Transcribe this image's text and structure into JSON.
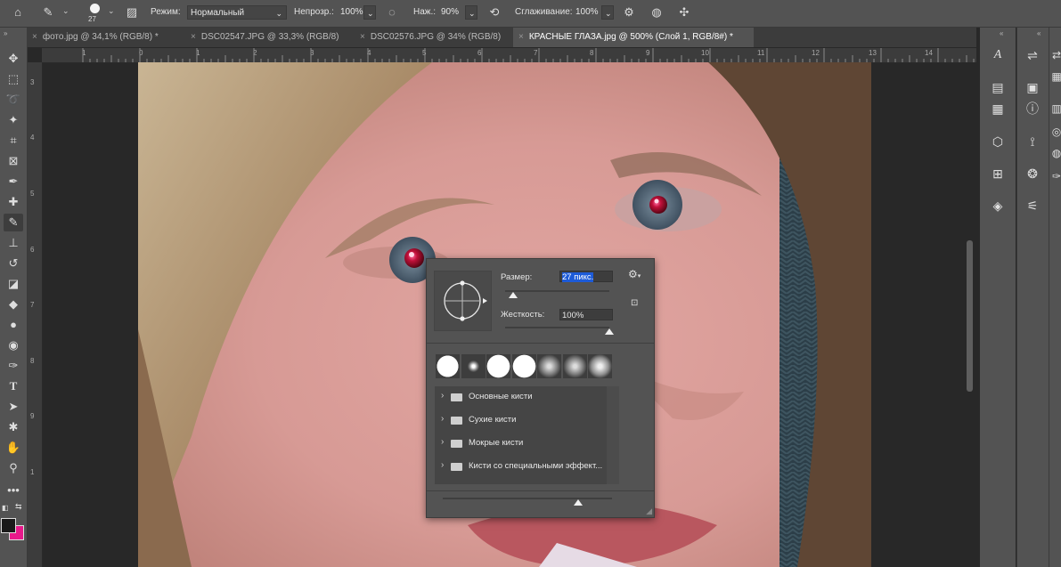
{
  "options_bar": {
    "brush_size": "27",
    "mode_label": "Режим:",
    "mode_value": "Нормальный",
    "opacity_label": "Непрозр.:",
    "opacity_value": "100%",
    "pressure_label": "Наж.:",
    "pressure_value": "90%",
    "smoothing_label": "Сглаживание:",
    "smoothing_value": "100%"
  },
  "tabs": [
    {
      "label": "фото.jpg @ 34,1% (RGB/8) *",
      "active": false
    },
    {
      "label": "DSC02547.JPG @ 33,3% (RGB/8)",
      "active": false
    },
    {
      "label": "DSC02576.JPG @ 34% (RGB/8)",
      "active": false
    },
    {
      "label": "КРАСНЫЕ ГЛАЗА.jpg @ 500% (Слой 1, RGB/8#) *",
      "active": true
    }
  ],
  "ruler": {
    "h_ticks": [
      "1",
      "0",
      "1",
      "2",
      "3",
      "4",
      "5",
      "6",
      "7",
      "8",
      "9",
      "10",
      "11",
      "12",
      "13",
      "14"
    ],
    "v_ticks": [
      "3",
      "4",
      "5",
      "6",
      "7",
      "8",
      "9",
      "1"
    ]
  },
  "brush_popup": {
    "size_label": "Размер:",
    "size_value": "27 пикс.",
    "size_slider": 0.08,
    "hardness_label": "Жесткость:",
    "hardness_value": "100%",
    "hardness_slider": 1.0,
    "presets": [
      "hard-round",
      "soft-round-small",
      "hard-round-large",
      "hard-round-pressure",
      "soft-round-airbrush",
      "soft-round-pressure",
      "soft-round-large"
    ],
    "folders": [
      "Основные кисти",
      "Сухие кисти",
      "Мокрые кисти",
      "Кисти со специальными эффект..."
    ],
    "bottom_slider": 0.8
  },
  "colors": {
    "foreground": "#1a1a1a",
    "background": "#e8198b",
    "accent_selection": "#1d5bd8"
  }
}
